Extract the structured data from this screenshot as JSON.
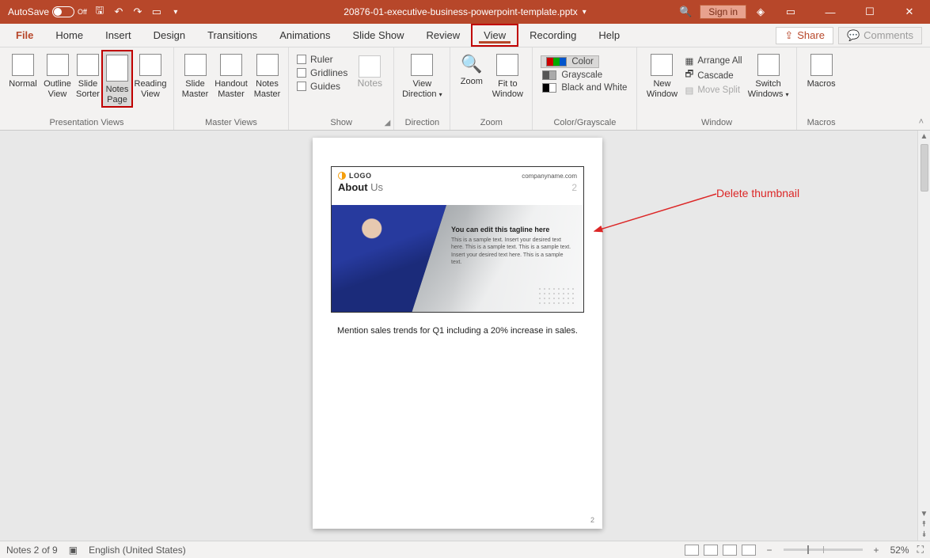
{
  "titlebar": {
    "autosave_label": "AutoSave",
    "autosave_state": "Off",
    "filename": "20876-01-executive-business-powerpoint-template.pptx",
    "signin_label": "Sign in"
  },
  "tabs": {
    "file": "File",
    "home": "Home",
    "insert": "Insert",
    "design": "Design",
    "transitions": "Transitions",
    "animations": "Animations",
    "slideshow": "Slide Show",
    "review": "Review",
    "view": "View",
    "recording": "Recording",
    "help": "Help",
    "share": "Share",
    "comments": "Comments"
  },
  "groups": {
    "presentation_views": {
      "label": "Presentation Views",
      "normal": "Normal",
      "outline_view_l1": "Outline",
      "outline_view_l2": "View",
      "slide_sorter_l1": "Slide",
      "slide_sorter_l2": "Sorter",
      "notes_page_l1": "Notes",
      "notes_page_l2": "Page",
      "reading_view_l1": "Reading",
      "reading_view_l2": "View"
    },
    "master_views": {
      "label": "Master Views",
      "slide_master_l1": "Slide",
      "slide_master_l2": "Master",
      "handout_master_l1": "Handout",
      "handout_master_l2": "Master",
      "notes_master_l1": "Notes",
      "notes_master_l2": "Master"
    },
    "show": {
      "label": "Show",
      "ruler": "Ruler",
      "gridlines": "Gridlines",
      "guides": "Guides",
      "notes": "Notes"
    },
    "direction": {
      "label": "Direction",
      "view_direction_l1": "View",
      "view_direction_l2": "Direction"
    },
    "zoom": {
      "label": "Zoom",
      "zoom": "Zoom",
      "fit_l1": "Fit to",
      "fit_l2": "Window"
    },
    "color_grayscale": {
      "label": "Color/Grayscale",
      "color": "Color",
      "grayscale": "Grayscale",
      "bw": "Black and White"
    },
    "window": {
      "label": "Window",
      "new_window_l1": "New",
      "new_window_l2": "Window",
      "arrange_all": "Arrange All",
      "cascade": "Cascade",
      "move_split": "Move Split",
      "switch_l1": "Switch",
      "switch_l2": "Windows"
    },
    "macros": {
      "label": "Macros",
      "macros": "Macros"
    }
  },
  "slide": {
    "logo_text": "LOGO",
    "company": "companyname.com",
    "about_us_1": "About",
    "about_us_2": "Us",
    "slide_number": "2",
    "tagline_title": "You can edit this tagline here",
    "tagline_text": "This is a sample text. Insert your desired text here. This is a sample text. This is a sample text. Insert your desired text here. This is a sample text."
  },
  "notes": {
    "text": "Mention sales trends for Q1 including a 20% increase in sales."
  },
  "annotation": {
    "text": "Delete thumbnail"
  },
  "statusbar": {
    "notes": "Notes 2 of 9",
    "language": "English (United States)",
    "zoom": "52%"
  },
  "page_number": "2"
}
